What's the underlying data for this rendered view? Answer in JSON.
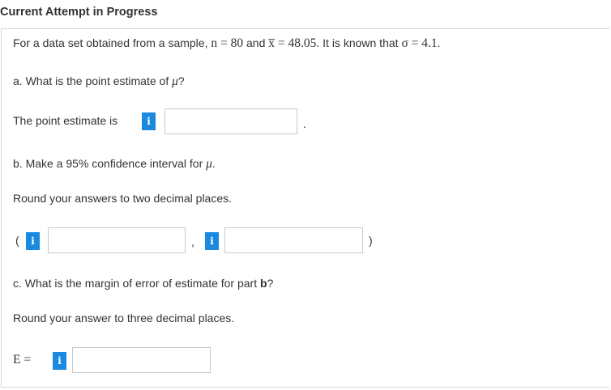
{
  "header": {
    "title": "Current Attempt in Progress"
  },
  "problem": {
    "intro_prefix": "For a data set obtained from a sample, ",
    "n_expr": "n = 80",
    "intro_and": " and ",
    "xbar_expr": "x̅ = 48.05",
    "intro_known": ". It is known that ",
    "sigma_expr": "σ = 4.1",
    "intro_end": "."
  },
  "part_a": {
    "question_prefix": "a. What is the point estimate of ",
    "mu": "μ",
    "question_suffix": "?",
    "answer_label": "The point estimate is",
    "info_icon_label": "i",
    "answer_value": "",
    "trailing": "."
  },
  "part_b": {
    "question_prefix": "b. Make a 95% confidence interval for ",
    "mu": "μ",
    "question_suffix": ".",
    "instruction": "Round your answers to two decimal places.",
    "open_paren": "(",
    "separator": ",",
    "close_paren": ")",
    "info_icon_label": "i",
    "lower_value": "",
    "upper_value": ""
  },
  "part_c": {
    "question_prefix": "c. What is the margin of error of estimate for part ",
    "question_bold": "b",
    "question_suffix": "?",
    "instruction": "Round your answer to three decimal places.",
    "answer_label": "E =",
    "info_icon_label": "i",
    "answer_value": ""
  },
  "colors": {
    "info_button": "#1a8ae0",
    "input_border": "#c9c9c9",
    "panel_border": "#d6d6d6",
    "text": "#333333"
  }
}
